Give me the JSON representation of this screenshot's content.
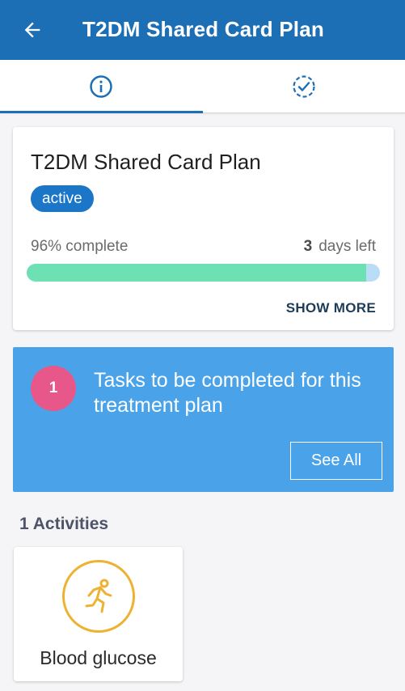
{
  "appbar": {
    "title": "T2DM Shared Card Plan",
    "back_icon": "arrow-left-icon"
  },
  "tabs": [
    {
      "id": "info",
      "icon": "info-circle-icon",
      "selected": true
    },
    {
      "id": "tasks",
      "icon": "check-circle-dashed-icon",
      "selected": false
    }
  ],
  "plan": {
    "title": "T2DM Shared Card Plan",
    "status": "active",
    "progress_text": "96% complete",
    "progress_fraction": 0.96,
    "days_left_count": "3",
    "days_left_label": "days left",
    "show_more": "SHOW MORE"
  },
  "tasks": {
    "count": "1",
    "message": "Tasks to be completed for this treatment plan",
    "see_all": "See All"
  },
  "activities": {
    "heading": "1 Activities",
    "items": [
      {
        "label": "Blood glucose",
        "icon": "running-person-icon"
      }
    ]
  },
  "colors": {
    "primary": "#1d6fb5",
    "badge": "#1b76c8",
    "progress_fill": "#6de0b4",
    "progress_track": "#b9dcf7",
    "tasks_card": "#4aa3e9",
    "task_count": "#e8578a",
    "activity_icon": "#eeb232"
  }
}
